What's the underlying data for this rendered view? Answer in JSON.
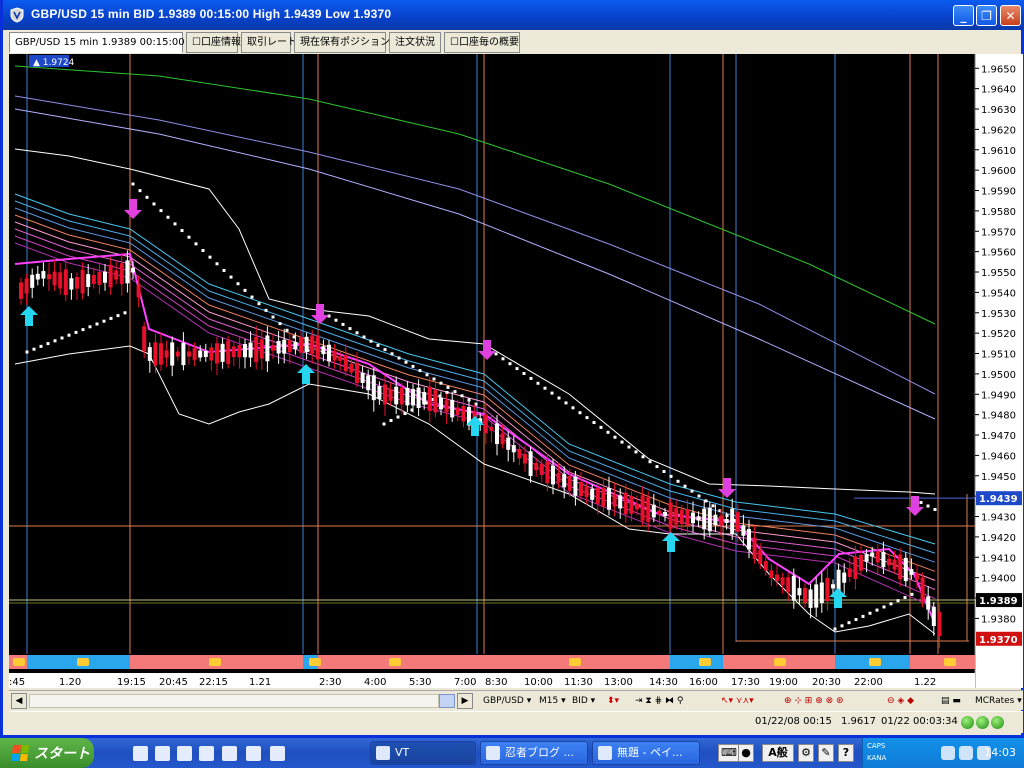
{
  "window": {
    "title": "GBP/USD 15 min BID 1.9389 00:15:00 High 1.9439 Low 1.9370",
    "controls": {
      "minimize": "_",
      "maximize": "❐",
      "close": "✕"
    }
  },
  "tabs": [
    {
      "label": "GBP/USD 15 min 1.9389 00:15:00",
      "active": true
    },
    {
      "label": "口座情報",
      "active": false
    },
    {
      "label": "取引レート",
      "active": false
    },
    {
      "label": "現在保有ポジション",
      "active": false
    },
    {
      "label": "注文状況",
      "active": false
    },
    {
      "label": "口座毎の概要",
      "active": false
    }
  ],
  "chart": {
    "top_left_label": "1.9724",
    "price_axis": {
      "ticks": [
        "1.9650",
        "1.9640",
        "1.9630",
        "1.9620",
        "1.9610",
        "1.9600",
        "1.9590",
        "1.9580",
        "1.9570",
        "1.9560",
        "1.9550",
        "1.9540",
        "1.9530",
        "1.9520",
        "1.9510",
        "1.9500",
        "1.9490",
        "1.9480",
        "1.9470",
        "1.9460",
        "1.9450",
        "1.9440",
        "1.9430",
        "1.9420",
        "1.9410",
        "1.9400",
        "1.9390",
        "1.9380"
      ],
      "ticks_values": [
        1.965,
        1.964,
        1.963,
        1.962,
        1.961,
        1.96,
        1.959,
        1.958,
        1.957,
        1.956,
        1.955,
        1.954,
        1.953,
        1.952,
        1.951,
        1.95,
        1.949,
        1.948,
        1.947,
        1.946,
        1.945,
        1.944,
        1.943,
        1.942,
        1.941,
        1.94,
        1.939,
        1.938
      ],
      "high_label": "1.9439",
      "high_value": 1.9439,
      "bid_label": "1.9389",
      "bid_value": 1.9389,
      "low_label": "1.9370",
      "low_value": 1.937,
      "min": 1.9364,
      "max": 1.9657
    },
    "time_axis": [
      ":45",
      "1.20",
      "19:15",
      "20:45",
      "22:15",
      "1.21",
      "2:30",
      "4:00",
      "5:30",
      "7:00",
      "8:30",
      "10:00",
      "11:30",
      "13:00",
      "14:30",
      "16:00",
      "17:30",
      "19:00",
      "20:30",
      "22:00",
      "1.22"
    ],
    "colors": {
      "bull": "#ffffff",
      "bear": "#e8102a",
      "up_arrow": "#26d6f0",
      "down_arrow": "#e040e0",
      "band_blue": "#2aa6ec",
      "band_pink": "#f47a7a"
    }
  },
  "toolbar": {
    "symbol": "GBP/USD",
    "timeframe": "M15",
    "price_type": "BID",
    "data_source": "MCRates"
  },
  "status": {
    "datetime": "01/22/08 00:15",
    "price": "1.9617",
    "clock": "01/22 00:03:34"
  },
  "taskbar": {
    "start_label": "スタート",
    "tasks": [
      {
        "label": "VT",
        "active": true
      },
      {
        "label": "忍者ブログ ...",
        "active": false
      },
      {
        "label": "無題 - ペイ...",
        "active": false
      }
    ],
    "ime": {
      "mode": "A",
      "kana": "般"
    },
    "tray_caps": "CAPS",
    "tray_kana": "KANA",
    "time": "14:03"
  }
}
